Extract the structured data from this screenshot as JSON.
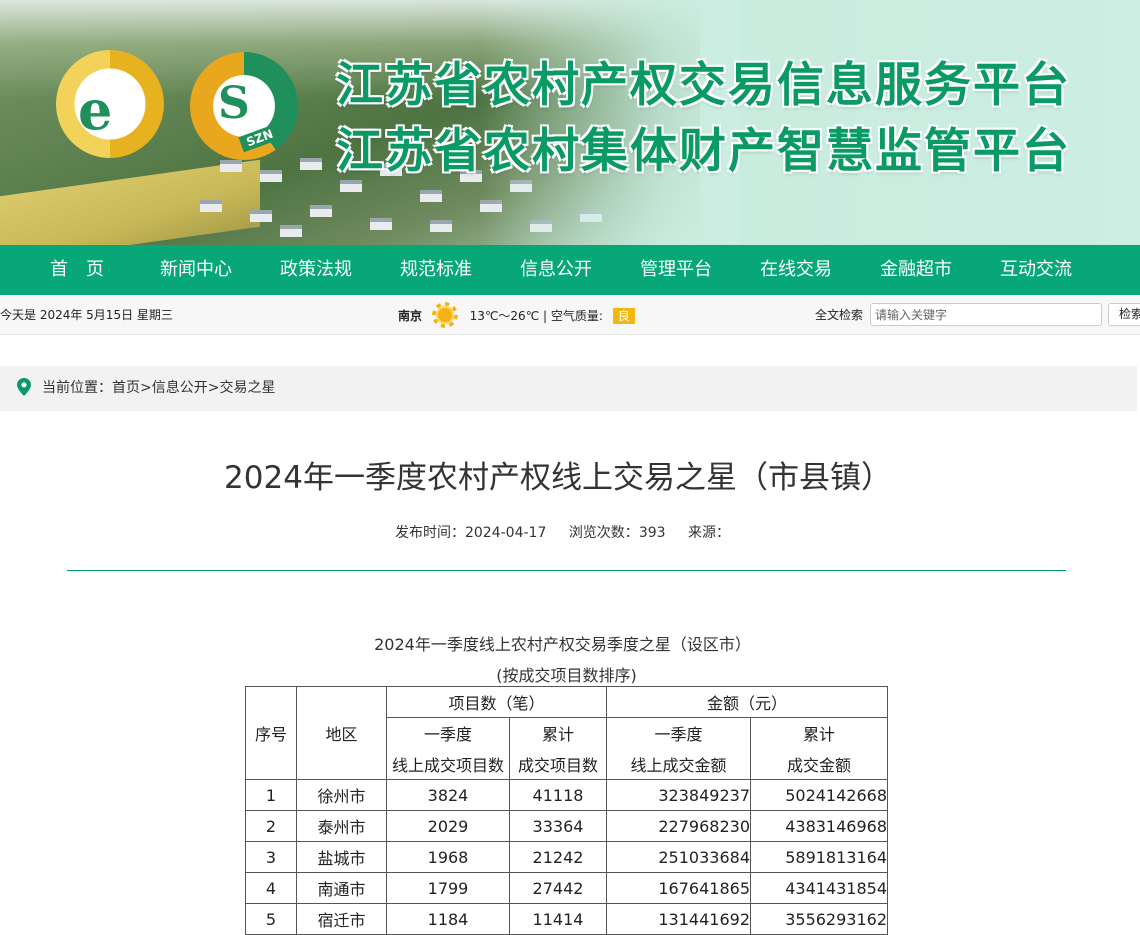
{
  "header": {
    "logo_left_letter": "e",
    "logo_right_letter": "S",
    "logo_right_tag": "SZN",
    "title_line1": "江苏省农村产权交易信息服务平台",
    "title_line2": "江苏省农村集体财产智慧监管平台",
    "brand_green": "#0a9a66"
  },
  "nav": {
    "items": [
      "首　页",
      "新闻中心",
      "政策法规",
      "规范标准",
      "信息公开",
      "管理平台",
      "在线交易",
      "金融超市",
      "互动交流"
    ],
    "bg_color": "#07a777"
  },
  "infobar": {
    "date": "今天是 2024年 5月15日 星期三",
    "city": "南京",
    "weather_icon": "sun-icon",
    "temperature": "13℃～26℃",
    "separator": "|",
    "air_label": "空气质量:",
    "air_value": "良",
    "search_label": "全文检索",
    "search_placeholder": "请输入关键字",
    "search_button": "检索"
  },
  "breadcrumb": {
    "icon": "location-pin-icon",
    "prefix": "当前位置：",
    "items": [
      "首页",
      "信息公开",
      "交易之星"
    ],
    "separator": ">"
  },
  "article": {
    "title": "2024年一季度农村产权线上交易之星（市县镇）",
    "publish_label": "发布时间：",
    "publish_date": "2024-04-17",
    "views_label": "浏览次数：",
    "views": "393",
    "source_label": "来源："
  },
  "table": {
    "title": "2024年一季度线上农村产权交易季度之星（设区市）",
    "subtitle": "(按成交项目数排序)",
    "headers": {
      "rank": "序号",
      "region": "地区",
      "projects_group": "项目数（笔）",
      "amount_group": "金额（元）",
      "q1_projects_l1": "一季度",
      "q1_projects_l2": "线上成交项目数",
      "cum_projects_l1": "累计",
      "cum_projects_l2": "成交项目数",
      "q1_amount_l1": "一季度",
      "q1_amount_l2": "线上成交金额",
      "cum_amount_l1": "累计",
      "cum_amount_l2": "成交金额"
    },
    "rows": [
      {
        "rank": "1",
        "region": "徐州市",
        "q1_projects": "3824",
        "cum_projects": "41118",
        "q1_amount": "323849237",
        "cum_amount": "5024142668"
      },
      {
        "rank": "2",
        "region": "泰州市",
        "q1_projects": "2029",
        "cum_projects": "33364",
        "q1_amount": "227968230",
        "cum_amount": "4383146968"
      },
      {
        "rank": "3",
        "region": "盐城市",
        "q1_projects": "1968",
        "cum_projects": "21242",
        "q1_amount": "251033684",
        "cum_amount": "5891813164"
      },
      {
        "rank": "4",
        "region": "南通市",
        "q1_projects": "1799",
        "cum_projects": "27442",
        "q1_amount": "167641865",
        "cum_amount": "4341431854"
      },
      {
        "rank": "5",
        "region": "宿迁市",
        "q1_projects": "1184",
        "cum_projects": "11414",
        "q1_amount": "131441692",
        "cum_amount": "3556293162"
      }
    ]
  }
}
